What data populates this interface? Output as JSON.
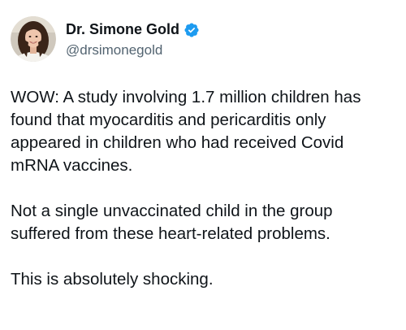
{
  "author": {
    "display_name": "Dr. Simone Gold",
    "handle": "@drsimonegold",
    "verified": true
  },
  "tweet": {
    "paragraphs": [
      "WOW: A study involving 1.7 million children has found that myocarditis and pericarditis only appeared in children who had received Covid mRNA vaccines.",
      "Not a single unvaccinated child in the group suffered from these heart-related problems.",
      "This is absolutely shocking."
    ]
  },
  "colors": {
    "text": "#0f1419",
    "secondary_text": "#536471",
    "verified_badge": "#1d9bf0",
    "background": "#ffffff"
  },
  "icons": {
    "avatar": "profile-photo",
    "badge": "verified-badge-icon"
  }
}
